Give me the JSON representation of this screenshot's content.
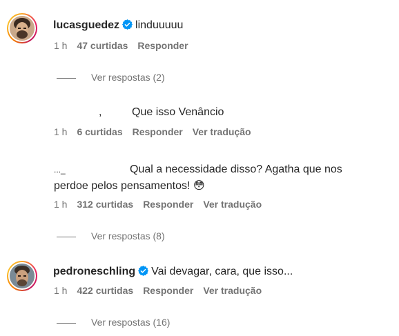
{
  "comments": [
    {
      "username": "lucasguedez",
      "text": "linduuuuu",
      "time": "1 h",
      "likes": "47 curtidas",
      "reply": "Responder",
      "view_replies": "Ver respostas (2)"
    },
    {
      "username_fragment": ",",
      "text": "Que isso Venâncio",
      "time": "1 h",
      "likes": "6 curtidas",
      "reply": "Responder",
      "translate": "Ver tradução"
    },
    {
      "username_fragment": "..._",
      "text_line1": "Qual a necessidade disso? Agatha que nos",
      "text_line2": "perdoe pelos pensamentos!",
      "emoji": "😳",
      "time": "1 h",
      "likes": "312 curtidas",
      "reply": "Responder",
      "translate": "Ver tradução",
      "view_replies": "Ver respostas (8)"
    },
    {
      "username": "pedroneschling",
      "text": "Vai devagar, cara, que isso...",
      "time": "1 h",
      "likes": "422 curtidas",
      "reply": "Responder",
      "translate": "Ver tradução",
      "view_replies": "Ver respostas (16)"
    }
  ],
  "colors": {
    "text": "#262626",
    "secondary": "#737373",
    "verified": "#0095f6"
  },
  "icons": [
    "verified-badge-icon",
    "avatar"
  ]
}
